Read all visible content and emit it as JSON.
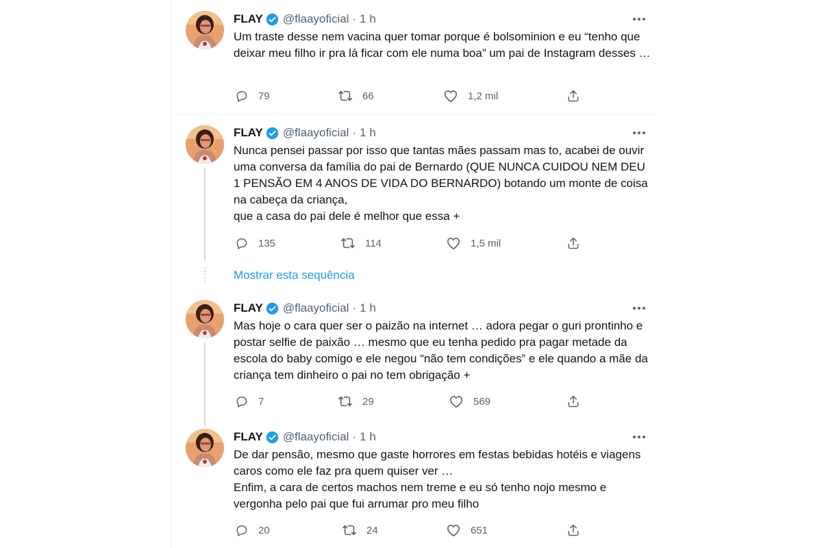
{
  "colors": {
    "accent": "#1d9bf0",
    "muted": "#536471",
    "text": "#0f1419"
  },
  "show_thread_label": "Mostrar esta sequência",
  "tweets": [
    {
      "name": "FLAY",
      "handle": "@flaayoficial",
      "separator": "·",
      "time": "1 h",
      "text": "Um traste desse nem vacina quer tomar porque é bolsominion e eu “tenho que deixar meu filho ir pra lá ficar com ele numa boa” um pai de Instagram desses …",
      "replies": "79",
      "retweets": "66",
      "likes": "1,2 mil"
    },
    {
      "name": "FLAY",
      "handle": "@flaayoficial",
      "separator": "·",
      "time": "1 h",
      "text": "Nunca pensei passar por isso que tantas mães passam mas to, acabei de ouvir uma conversa da família do pai de Bernardo (QUE NUNCA CUIDOU NEM DEU 1 PENSÃO EM 4 ANOS DE VIDA DO BERNARDO) botando um monte de coisa na cabeça da criança,\nque a casa do pai dele é melhor que essa +",
      "replies": "135",
      "retweets": "114",
      "likes": "1,5 mil"
    },
    {
      "name": "FLAY",
      "handle": "@flaayoficial",
      "separator": "·",
      "time": "1 h",
      "text": "Mas hoje o cara quer ser o paizão na internet … adora pegar o guri prontinho e postar selfie de paixão … mesmo que eu tenha pedido pra pagar metade da escola do baby comigo e ele negou “não tem condições” e ele quando a mãe da criança tem dinheiro o pai no tem obrigação +",
      "replies": "7",
      "retweets": "29",
      "likes": "569"
    },
    {
      "name": "FLAY",
      "handle": "@flaayoficial",
      "separator": "·",
      "time": "1 h",
      "text": "De dar pensão, mesmo que gaste horrores em festas bebidas hotéis e viagens caros como ele faz pra quem quiser ver …\nEnfim, a cara de certos machos nem treme e eu só tenho nojo mesmo e vergonha pelo pai que fui arrumar pro meu filho",
      "replies": "20",
      "retweets": "24",
      "likes": "651"
    }
  ]
}
